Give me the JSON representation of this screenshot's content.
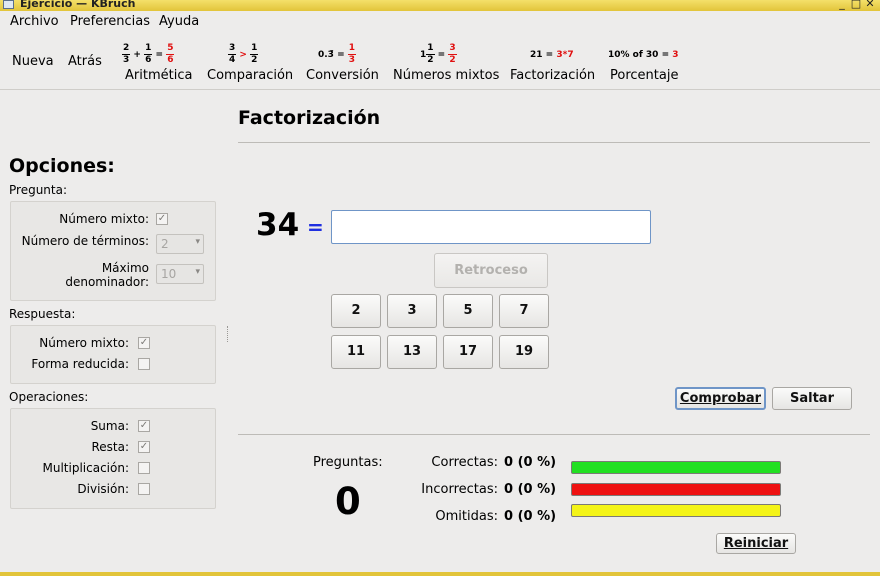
{
  "window": {
    "title": "Ejercicio — KBruch"
  },
  "menu": [
    "Archivo",
    "Preferencias",
    "Ayuda"
  ],
  "toolbar": {
    "nueva": "Nueva",
    "atras": "Atrás",
    "modes": {
      "aritmetica": "Aritmética",
      "comparacion": "Comparación",
      "conversion": "Conversión",
      "mixtos": "Números mixtos",
      "factorizacion": "Factorización",
      "porcentaje": "Porcentaje"
    },
    "icons": {
      "arit": {
        "a_n": "2",
        "a_d": "3",
        "op": "+",
        "b_n": "1",
        "b_d": "6",
        "eq": "=",
        "r_n": "5",
        "r_d": "6"
      },
      "comp": {
        "a_n": "3",
        "a_d": "4",
        "op": ">",
        "b_n": "1",
        "b_d": "2"
      },
      "conv": {
        "dec": "0.3̄ =",
        "r_n": "1",
        "r_d": "3"
      },
      "mix": {
        "whole": "1",
        "a_n": "1",
        "a_d": "2",
        "eq": "=",
        "r_n": "3",
        "r_d": "2"
      },
      "fact": {
        "lhs": "21 =",
        "rhs": "3*7"
      },
      "pct": {
        "lhs": "10% of 30 =",
        "rhs": "3"
      }
    }
  },
  "options": {
    "heading": "Opciones:",
    "pregunta": {
      "title": "Pregunta:",
      "mixed_label": "Número mixto:",
      "mixed_checked": true,
      "terms_label": "Número de términos:",
      "terms_value": "2",
      "maxden_label_1": "Máximo",
      "maxden_label_2": "denominador:",
      "maxden_value": "10"
    },
    "respuesta": {
      "title": "Respuesta:",
      "mixed_label": "Número mixto:",
      "mixed_checked": true,
      "reduced_label": "Forma reducida:",
      "reduced_checked": false
    },
    "operaciones": {
      "title": "Operaciones:",
      "suma": "Suma:",
      "suma_checked": true,
      "resta": "Resta:",
      "resta_checked": true,
      "mult": "Multiplicación:",
      "mult_checked": false,
      "div": "División:",
      "div_checked": false
    }
  },
  "exercise": {
    "title": "Factorización",
    "number": "34",
    "equals": "=",
    "answer": "",
    "backspace": "Retroceso",
    "factors": [
      "2",
      "3",
      "5",
      "7",
      "11",
      "13",
      "17",
      "19"
    ],
    "check": "Comprobar",
    "skip": "Saltar"
  },
  "stats": {
    "questions_label": "Preguntas:",
    "questions_value": "0",
    "correct_label": "Correctas:",
    "correct_value": "0 (0 %)",
    "incorrect_label": "Incorrectas:",
    "incorrect_value": "0 (0 %)",
    "skipped_label": "Omitidas:",
    "skipped_value": "0 (0 %)",
    "reset": "Reiniciar",
    "colors": {
      "correct": "#22e022",
      "incorrect": "#ee1111",
      "skipped": "#f4f418"
    }
  }
}
